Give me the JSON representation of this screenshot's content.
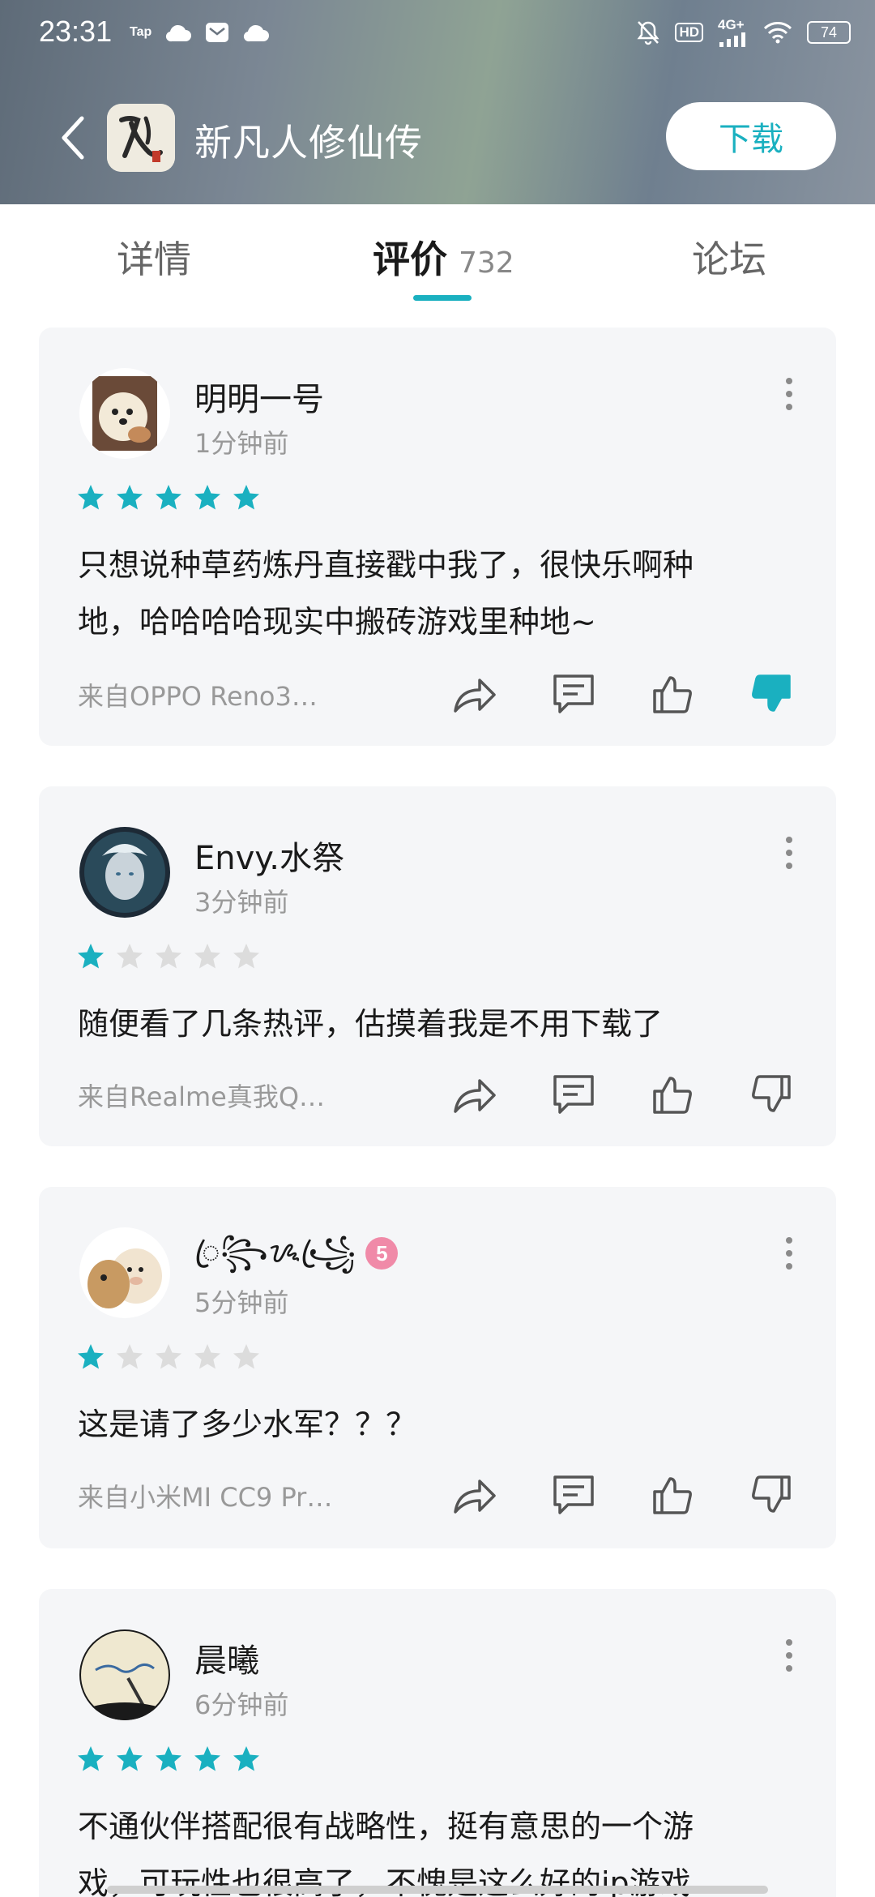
{
  "status_bar": {
    "time": "23:31",
    "left_icons": [
      "taptap-icon",
      "cloud-icon",
      "mail-icon",
      "cloud-icon"
    ],
    "right_icons": [
      "bell-off-icon",
      "hd-icon",
      "signal-4g-icon",
      "wifi-icon"
    ],
    "network": "4G+",
    "battery": "74"
  },
  "header": {
    "app_title": "新凡人修仙传",
    "download_label": "下载",
    "app_icon_text": "凡人"
  },
  "tabs": [
    {
      "label": "详情",
      "active": false
    },
    {
      "label": "评价",
      "count": "732",
      "active": true
    },
    {
      "label": "论坛",
      "active": false
    }
  ],
  "reviews": [
    {
      "username": "明明一号",
      "time": "1分钟前",
      "rating": 5,
      "text_lines": [
        "只想说种草药炼丹直接戳中我了，很快乐啊种",
        "地，哈哈哈哈现实中搬砖游戏里种地~"
      ],
      "device": "来自OPPO Reno3…",
      "disliked": true
    },
    {
      "username": "Envy.水祭",
      "time": "3分钟前",
      "rating": 1,
      "text_lines": [
        "随便看了几条热评，估摸着我是不用下载了"
      ],
      "device": "来自Realme真我Q…",
      "disliked": false
    },
    {
      "username": "ꦿ꧂ᝰ꧁ꦿ",
      "level": "5",
      "time": "5分钟前",
      "rating": 1,
      "text_lines": [
        "这是请了多少水军？？？"
      ],
      "device": "来自小米MI CC9 Pr…",
      "disliked": false
    },
    {
      "username": "晨曦",
      "time": "6分钟前",
      "rating": 5,
      "text_lines": [
        "不通伙伴搭配很有战略性，挺有意思的一个游",
        "戏，可玩性也很高了，不愧是这么好的ip游戏"
      ],
      "device": "",
      "disliked": false
    }
  ],
  "colors": {
    "accent": "#1ab0c0",
    "star_empty": "#dcdcdc",
    "card_bg": "#f5f6f8"
  }
}
